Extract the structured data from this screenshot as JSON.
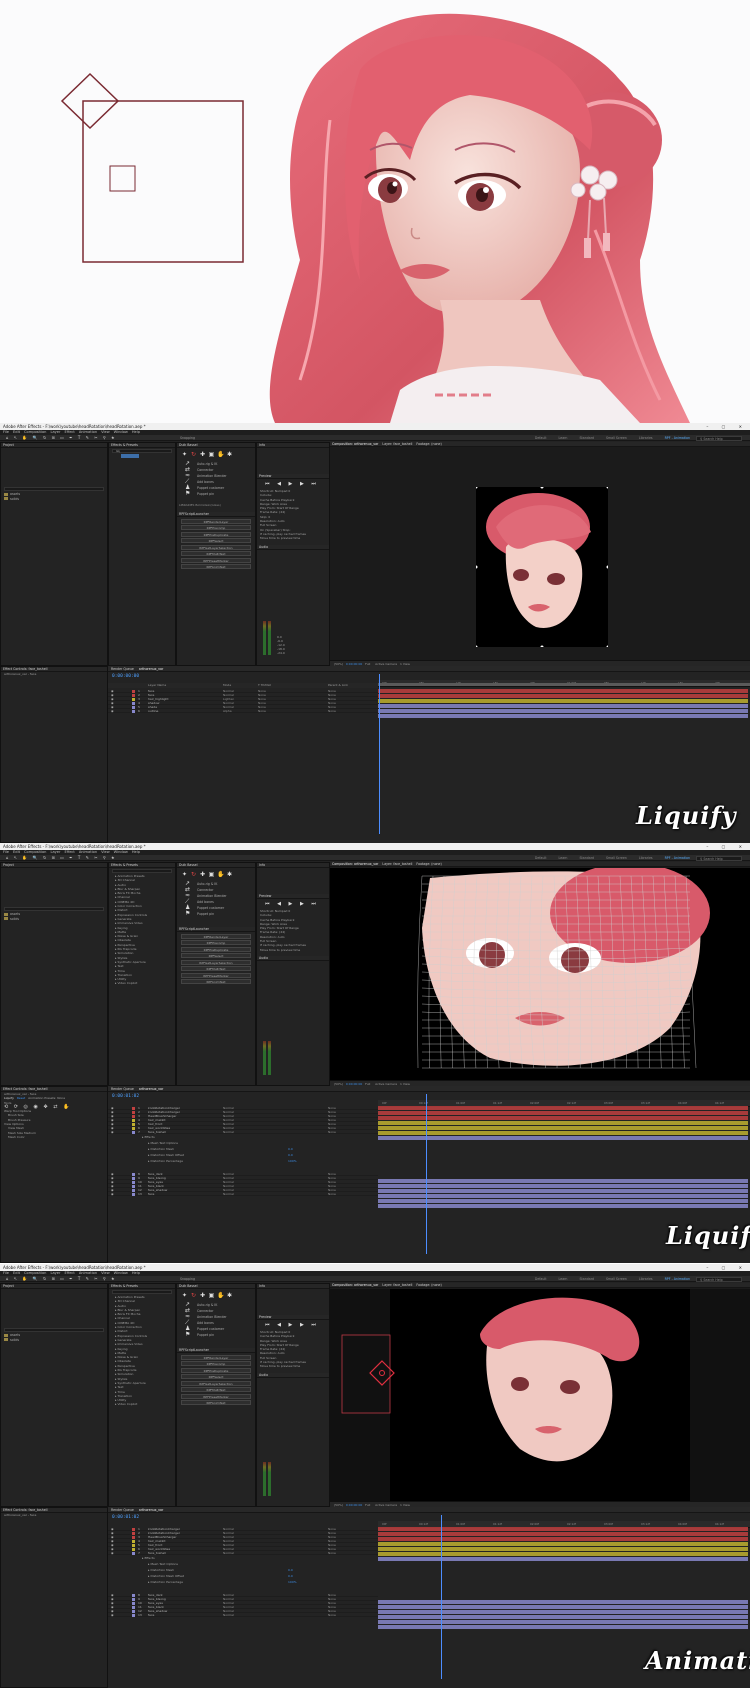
{
  "app": {
    "title": "Adobe After Effects - F:\\work\\youtube\\headRotation\\headRotation.aep *",
    "menu": [
      "File",
      "Edit",
      "Composition",
      "Layer",
      "Effect",
      "Animation",
      "View",
      "Window",
      "Help"
    ],
    "workspaces": [
      "Default",
      "Learn",
      "Standard",
      "Small Screen",
      "Libraries",
      "RPF - Animation"
    ],
    "search_help": "Search Help",
    "snapping": "Snapping"
  },
  "panels": {
    "project": "Project",
    "effects": "Effects & Presets",
    "duik": "Duik Bassel",
    "info": "Info",
    "preview": "Preview",
    "audio": "Audio",
    "render_queue": "Render Queue",
    "composition_tab": "Composition: arthorenux_var",
    "layer_tab": "Layer: face_toshell",
    "footage_tab": "Footage: (none)",
    "rpi_launcher": "RPFScriptLauncher",
    "libraries": "LIBRARIES Bolmstein(Glass)"
  },
  "project_items": [
    "assets",
    "solids"
  ],
  "effects_search": "liq",
  "effects_categories": [
    "Animation Presets",
    "3D Channel",
    "Audio",
    "Blur & Sharpen",
    "Boris FX Mocha",
    "Channel",
    "CINEMA 4D",
    "Color Correction",
    "Distort",
    "Expression Controls",
    "Generate",
    "Immersive Video",
    "Keying",
    "Matte",
    "Noise & Grain",
    "Obsolete",
    "Perspective",
    "RG Trapcode",
    "Simulation",
    "Stylize",
    "Synthetic Aperture",
    "Text",
    "Time",
    "Transition",
    "Utility",
    "Video Copilot"
  ],
  "duik_items": [
    "Auto-rig & IK",
    "Connector",
    "Animation Blender",
    "Add bones",
    "Puppet customer",
    "Puppet pin"
  ],
  "scripts": [
    "RPFRenderLayer",
    "RPFPrecomp",
    "RPFPreDuplicate",
    "RPFSelect",
    "RPFGetLayerSelection",
    "RPFMultiText",
    "RPFPresetMarker",
    "RPFAnimText"
  ],
  "preview": {
    "shortcut": "Shortcut: Numpad 0",
    "include": "Include:",
    "cache": "Cache Before Playback",
    "range": "Range: Work Area",
    "play_from": "Play From: Start Of Range",
    "frame_rate": "Frame Rate: (24)",
    "skip": "Skip: 0",
    "resolution": "Resolution: Auto",
    "full_screen": "Full Screen",
    "stop_label": "On (Spacebar) Stop:",
    "cache_if": "If caching, play cached frames",
    "move_time": "Move time to preview time"
  },
  "audio_db": [
    "0.0",
    "-3.0",
    "-6.0",
    "-9.0",
    "-12.0",
    "-15.0",
    "-18.0",
    "-21.0",
    "-24.0"
  ],
  "viewer": {
    "zoom": "(50%)",
    "timecode": "0:00:00:00",
    "quality": "Full",
    "camera": "Active Camera",
    "view": "1 View"
  },
  "timeline": {
    "tab": "arthorenux_var",
    "timecode_1": "0:00:00:00",
    "timecode_2": "0:00:01:02",
    "timecode_3": "0:00:01:02",
    "headers": [
      "Layer Name",
      "Mode",
      "T TrkMat",
      "Parent & Link"
    ],
    "ruler_1": [
      "00f",
      "05f",
      "10f",
      "15f",
      "20f",
      "01:00f",
      "05f",
      "10f",
      "15f",
      "20f"
    ],
    "ruler_2": [
      "00f",
      "00:12f",
      "01:00f",
      "01:12f",
      "02:00f",
      "02:12f",
      "03:00f",
      "03:12f",
      "04:00f",
      "04:12f"
    ],
    "layers_1": [
      {
        "name": "face",
        "mode": "Normal",
        "trk": "None",
        "color": "#c04040"
      },
      {
        "name": "face",
        "mode": "Normal",
        "trk": "None",
        "color": "#c04040"
      },
      {
        "name": "hair_highlight",
        "mode": "Lighten",
        "trk": "None",
        "color": "#c0b030"
      },
      {
        "name": "shadow",
        "mode": "Normal",
        "trk": "None",
        "color": "#8888cc"
      },
      {
        "name": "shade",
        "mode": "Normal",
        "trk": "None",
        "color": "#8888cc"
      },
      {
        "name": "outline",
        "mode": "Alpha",
        "trk": "None",
        "color": "#8888cc"
      }
    ],
    "layers_2": [
      {
        "name": "knobRotationCharger",
        "mode": "Normal",
        "color": "#c04040"
      },
      {
        "name": "knobRotationCharger",
        "mode": "Normal",
        "color": "#c04040"
      },
      {
        "name": "HeadBrushCharger",
        "mode": "Normal",
        "color": "#c04040"
      },
      {
        "name": "hair_mekkit",
        "mode": "Normal",
        "color": "#c0b030"
      },
      {
        "name": "hair_front",
        "mode": "Normal",
        "color": "#c0b030"
      },
      {
        "name": "hair_worldIdea",
        "mode": "Normal",
        "color": "#c0b030"
      },
      {
        "name": "face_toshell",
        "mode": "Normal",
        "color": "#8888cc"
      },
      {
        "name": "face_dark",
        "mode": "Normal",
        "color": "#8888cc"
      },
      {
        "name": "face_blsong",
        "mode": "Normal",
        "color": "#8888cc"
      },
      {
        "name": "face_eyes",
        "mode": "Normal",
        "color": "#8888cc"
      },
      {
        "name": "face_black",
        "mode": "Normal",
        "color": "#8888cc"
      },
      {
        "name": "face_shadow",
        "mode": "Normal",
        "color": "#8888cc"
      },
      {
        "name": "face",
        "mode": "Normal",
        "color": "#8888cc"
      }
    ],
    "effect_props": [
      "Effects",
      "Mesh Text Options",
      "Distortion Mesh",
      "Distortion Mesh Offset",
      "Distortion Percentage"
    ],
    "effect_values": [
      "0.0",
      "0.0",
      "100%"
    ]
  },
  "effect_controls": {
    "title": "Effect Controls: face_toshell",
    "layer": "arthorenux_var - face",
    "effect": "Liquify",
    "reset": "Reset",
    "presets": "Animation Presets: None",
    "tools": "Tools",
    "view_options": "View Options",
    "warp_tool": "Warp Tool Options",
    "brush_size": "Brush Size",
    "brush_pressure": "Brush Pressure",
    "view_mesh": "View Mesh",
    "mesh_size": "Mesh Size",
    "mesh_size_val": "Medium",
    "mesh_color": "Mesh Color"
  },
  "captions": [
    "Liquify",
    "Liquify",
    "Animating"
  ],
  "colors": {
    "hair": "#d85a6a",
    "timeline_blue": "#4c8dff",
    "bar_red": "#c05050",
    "bar_yellow": "#c8b040",
    "bar_lilac": "#9090c0"
  }
}
